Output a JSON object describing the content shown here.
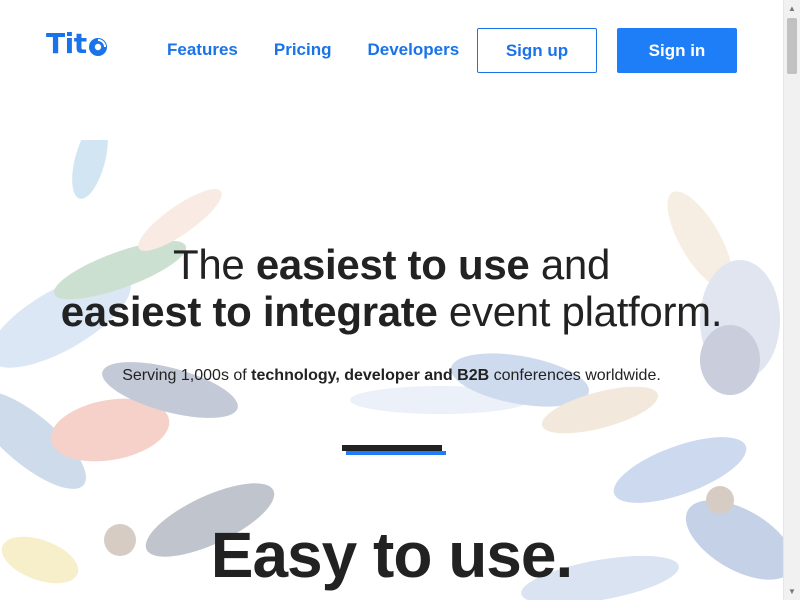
{
  "brand": {
    "name": "Tito",
    "logo_letters": "Tit",
    "color": "#1a73e8"
  },
  "nav": {
    "links": [
      {
        "label": "Features"
      },
      {
        "label": "Pricing"
      },
      {
        "label": "Developers"
      }
    ],
    "signup_label": "Sign up",
    "signin_label": "Sign in",
    "signin_color": "#1e7ef7"
  },
  "hero": {
    "title_line1_pre": "The ",
    "title_line1_bold": "easiest to use",
    "title_line1_post": " and",
    "title_line2_bold": "easiest to integrate",
    "title_line2_post": " event platform.",
    "subtitle_pre": "Serving 1,000s of ",
    "subtitle_bold": "technology, developer and B2B",
    "subtitle_post": " conferences worldwide."
  },
  "section": {
    "title": "Easy to use."
  },
  "icons": [
    "tito-logo-icon",
    "scroll-up-icon",
    "scroll-down-icon"
  ]
}
